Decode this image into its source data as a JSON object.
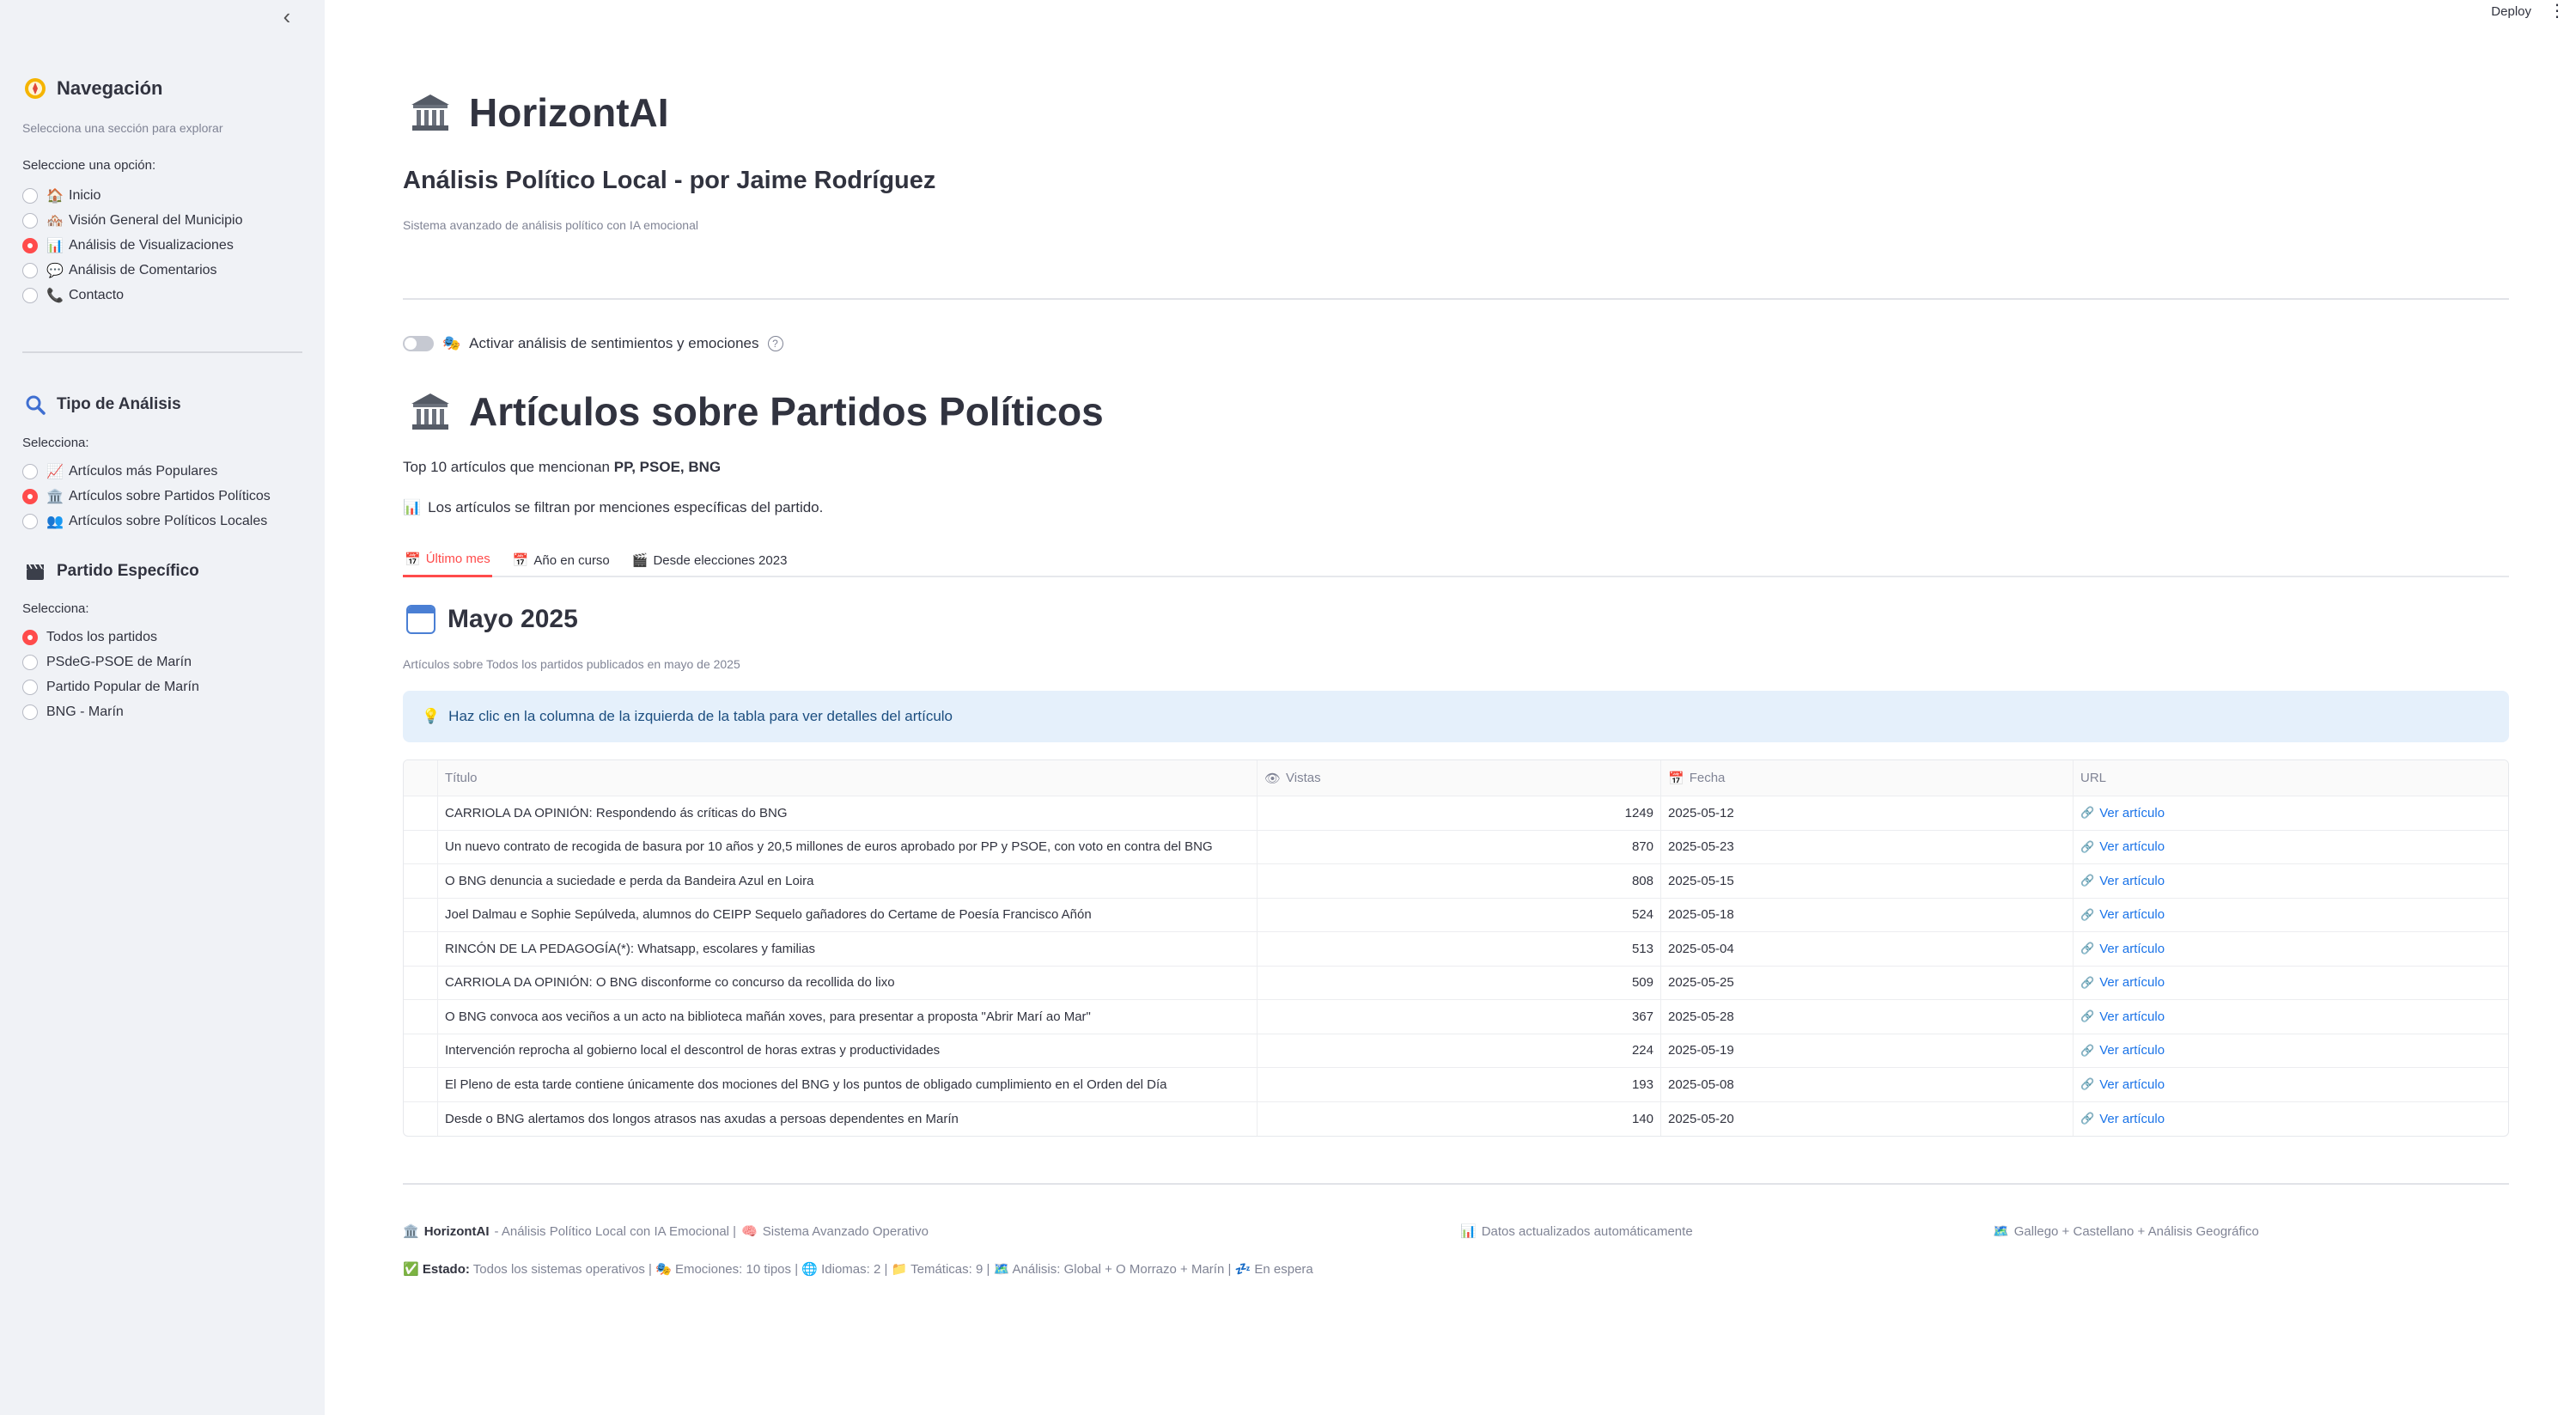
{
  "sidebar": {
    "collapse_glyph": "‹",
    "nav": {
      "title": "Navegación",
      "icon": "compass-icon",
      "subtitle": "Selecciona una sección para explorar",
      "prompt": "Seleccione una opción:",
      "options": [
        {
          "emoji": "🏠",
          "label": "Inicio",
          "selected": false
        },
        {
          "emoji": "🏘️",
          "label": "Visión General del Municipio",
          "selected": false
        },
        {
          "emoji": "📊",
          "label": "Análisis de Visualizaciones",
          "selected": true
        },
        {
          "emoji": "💬",
          "label": "Análisis de Comentarios",
          "selected": false
        },
        {
          "emoji": "📞",
          "label": "Contacto",
          "selected": false
        }
      ]
    },
    "analysis": {
      "title": "Tipo de Análisis",
      "icon": "magnifier-icon",
      "prompt": "Selecciona:",
      "options": [
        {
          "emoji": "📈",
          "label": "Artículos más Populares",
          "selected": false
        },
        {
          "emoji": "🏛️",
          "label": "Artículos sobre Partidos Políticos",
          "selected": true
        },
        {
          "emoji": "👥",
          "label": "Artículos sobre Políticos Locales",
          "selected": false
        }
      ]
    },
    "party": {
      "title": "Partido Específico",
      "icon": "clapper-icon",
      "prompt": "Selecciona:",
      "options": [
        {
          "label": "Todos los partidos",
          "selected": true
        },
        {
          "label": "PSdeG-PSOE de Marín",
          "selected": false
        },
        {
          "label": "Partido Popular de Marín",
          "selected": false
        },
        {
          "label": "BNG - Marín",
          "selected": false
        }
      ]
    }
  },
  "topbar": {
    "deploy": "Deploy",
    "menu_glyph": "⋮"
  },
  "header": {
    "title": "HorizontAI",
    "subtitle": "Análisis Político Local - por Jaime Rodríguez",
    "tagline": "Sistema avanzado de análisis político con IA emocional"
  },
  "toggle": {
    "emoji": "🎭",
    "label": "Activar análisis de sentimientos y emociones",
    "on": false,
    "help": "?"
  },
  "section": {
    "title": "Artículos sobre Partidos Políticos",
    "desc_prefix": "Top 10 artículos que mencionan",
    "desc_parties": "PP, PSOE, BNG",
    "note_emoji": "📊",
    "note": "Los artículos se filtran por menciones específicas del partido."
  },
  "tabs": [
    {
      "emoji": "📅",
      "label": "Último mes",
      "active": true
    },
    {
      "emoji": "📅",
      "label": "Año en curso",
      "active": false
    },
    {
      "emoji": "🎬",
      "label": "Desde elecciones 2023",
      "active": false
    }
  ],
  "month": {
    "title": "Mayo 2025",
    "caption": "Artículos sobre Todos los partidos publicados en mayo de 2025"
  },
  "info": {
    "emoji": "💡",
    "text": "Haz clic en la columna de la izquierda de la tabla para ver detalles del artículo"
  },
  "table": {
    "headers": {
      "title": "Título",
      "views_emoji": "👁",
      "views": "Vistas",
      "date_emoji": "📅",
      "date": "Fecha",
      "url": "URL"
    },
    "link_emoji": "🔗",
    "rows": [
      {
        "title": "CARRIOLA DA OPINIÓN: Respondendo ás críticas do BNG",
        "views": "1249",
        "date": "2025-05-12",
        "url": "Ver artículo"
      },
      {
        "title": "Un nuevo contrato de recogida de basura por 10 años y 20,5 millones de euros aprobado por PP y PSOE, con  voto en contra del BNG",
        "views": "870",
        "date": "2025-05-23",
        "url": "Ver artículo"
      },
      {
        "title": "O BNG denuncia a suciedade e perda da Bandeira Azul en Loira",
        "views": "808",
        "date": "2025-05-15",
        "url": "Ver artículo"
      },
      {
        "title": "Joel Dalmau e Sophie Sepúlveda, alumnos do CEIPP Sequelo gañadores do Certame de Poesía Francisco Añón",
        "views": "524",
        "date": "2025-05-18",
        "url": "Ver artículo"
      },
      {
        "title": "RINCÓN DE LA PEDAGOGÍA(*): Whatsapp, escolares y familias",
        "views": "513",
        "date": "2025-05-04",
        "url": "Ver artículo"
      },
      {
        "title": "CARRIOLA DA OPINIÓN: O BNG disconforme co concurso da recollida do lixo",
        "views": "509",
        "date": "2025-05-25",
        "url": "Ver artículo"
      },
      {
        "title": "O BNG convoca aos veciños a un acto na biblioteca mañán xoves, para presentar a proposta \"Abrir Marí ao Mar\"",
        "views": "367",
        "date": "2025-05-28",
        "url": "Ver artículo"
      },
      {
        "title": "Intervención reprocha al gobierno local el descontrol de horas extras y productividades",
        "views": "224",
        "date": "2025-05-19",
        "url": "Ver artículo"
      },
      {
        "title": "El Pleno de esta tarde  contiene únicamente dos mociones del BNG y los puntos de obligado cumplimiento en el Orden del Día",
        "views": "193",
        "date": "2025-05-08",
        "url": "Ver artículo"
      },
      {
        "title": "Desde o BNG alertamos dos longos atrasos nas axudas a persoas dependentes en Marín",
        "views": "140",
        "date": "2025-05-20",
        "url": "Ver artículo"
      }
    ]
  },
  "footer": {
    "left_emoji": "🏛️",
    "left_bold": "HorizontAI",
    "left_text": "- Análisis Político Local con IA Emocional |",
    "left_emoji2": "🧠",
    "left_text2": "Sistema Avanzado Operativo",
    "mid_emoji": "📊",
    "mid": "Datos actualizados automáticamente",
    "right_emoji": "🗺️",
    "right": "Gallego + Castellano + Análisis Geográfico",
    "status_emoji": "✅",
    "status_bold": "Estado:",
    "status": "Todos los sistemas operativos | 🎭 Emociones: 10 tipos | 🌐 Idiomas: 2 | 📁 Temáticas: 9 | 🗺️ Análisis: Global + O Morrazo + Marín | 💤 En espera"
  }
}
